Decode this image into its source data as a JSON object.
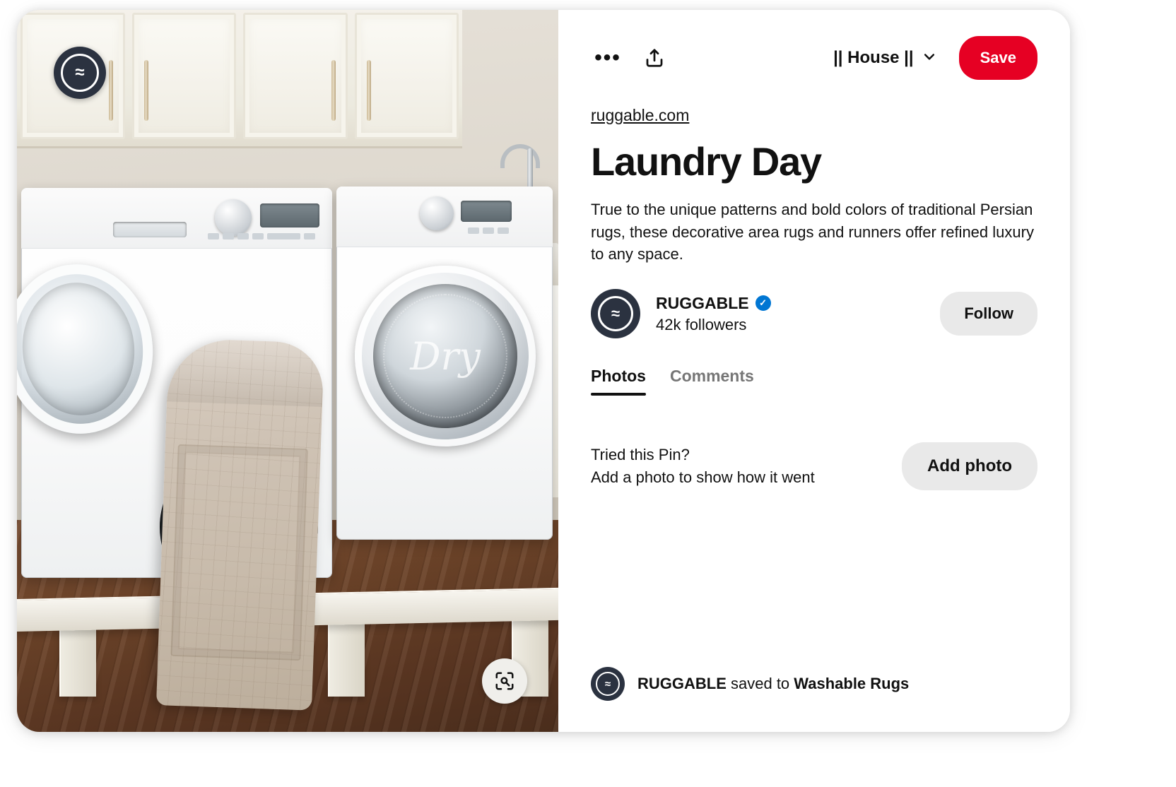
{
  "photo": {
    "brand_badge_icon": "ruggable-wave-logo-icon",
    "visual_search_icon": "visual-search-icon",
    "dryer_door_label": "Dry",
    "alt": "laundry room with white washer and dryer and a patterned rug laundry bag"
  },
  "actions": {
    "more_options_icon": "more-options-icon",
    "more_options_label": "•••",
    "share_icon": "share-icon",
    "board_name": "|| House ||",
    "board_chevron_icon": "chevron-down-icon",
    "save_label": "Save",
    "save_color": "#e60023"
  },
  "pin": {
    "source_link": "ruggable.com",
    "title": "Laundry Day",
    "description": "True to the unique patterns and bold colors of traditional Persian rugs, these decorative area rugs and runners offer refined luxury to any space."
  },
  "creator": {
    "avatar_icon": "ruggable-wave-logo-icon",
    "name": "RUGGABLE",
    "verified_icon": "verified-badge-icon",
    "verified_glyph": "✓",
    "followers": "42k followers",
    "follow_label": "Follow"
  },
  "tabs": [
    {
      "label": "Photos",
      "active": true
    },
    {
      "label": "Comments",
      "active": false
    }
  ],
  "tried_this": {
    "heading": "Tried this Pin?",
    "subtext": "Add a photo to show how it went",
    "button_label": "Add photo"
  },
  "footer": {
    "avatar_icon": "ruggable-wave-logo-icon",
    "user": "RUGGABLE",
    "middle": " saved to ",
    "board": "Washable Rugs"
  }
}
